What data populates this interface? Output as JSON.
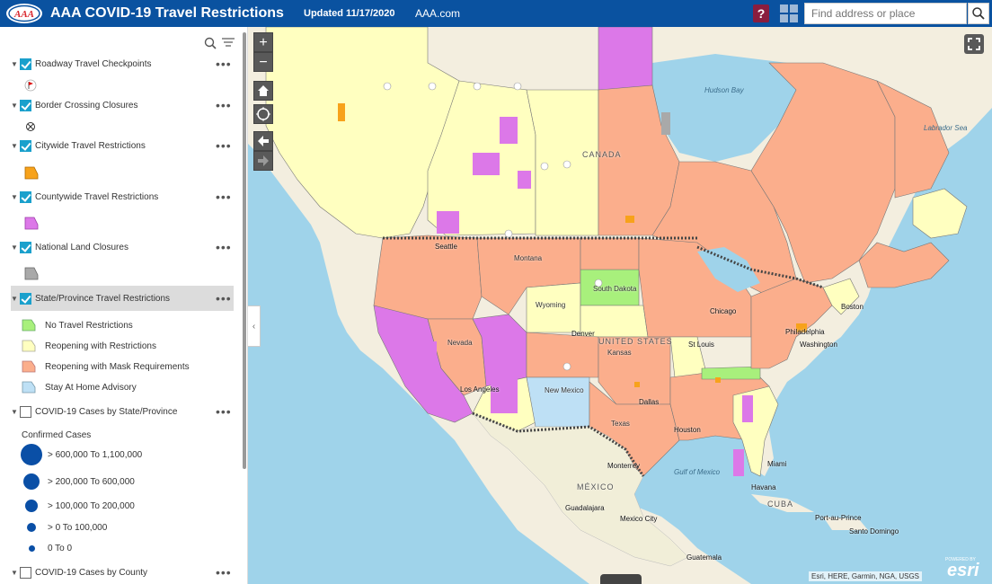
{
  "header": {
    "title": "AAA COVID-19 Travel Restrictions",
    "logo_text": "AAA",
    "updated": "Updated 11/17/2020",
    "link": "AAA.com",
    "help": "?",
    "search_placeholder": "Find address or place"
  },
  "colors": {
    "header_bg": "#0a52a0",
    "no_restrictions": "#a8f07c",
    "reopening_restrictions": "#ffffc0",
    "reopening_masks": "#fbae8c",
    "stay_at_home": "#bee0f5",
    "citywide": "#f7a21b",
    "countywide": "#dc78e8",
    "national_land": "#a9a9a9",
    "cases": "#0a4fa6"
  },
  "layers": [
    {
      "label": "Roadway Travel Checkpoints",
      "checked": true,
      "symbol": "flag-icon"
    },
    {
      "label": "Border Crossing Closures",
      "checked": true,
      "symbol": "crossed-circle-icon"
    },
    {
      "label": "Citywide Travel Restrictions",
      "checked": true,
      "symbol": "orange-polygon"
    },
    {
      "label": "Countywide Travel Restrictions",
      "checked": true,
      "symbol": "magenta-polygon"
    },
    {
      "label": "National Land Closures",
      "checked": true,
      "symbol": "gray-polygon"
    },
    {
      "label": "State/Province Travel Restrictions",
      "checked": true,
      "symbol": ""
    },
    {
      "label": "COVID-19 Cases by State/Province",
      "checked": false,
      "symbol": ""
    },
    {
      "label": "COVID-19 Cases by County",
      "checked": false,
      "symbol": ""
    }
  ],
  "state_legend": [
    {
      "label": "No Travel Restrictions"
    },
    {
      "label": "Reopening with Restrictions"
    },
    {
      "label": "Reopening with Mask Requirements"
    },
    {
      "label": "Stay At Home Advisory"
    }
  ],
  "cases_legend": {
    "title": "Confirmed Cases",
    "items": [
      {
        "label": "> 600,000 To 1,100,000"
      },
      {
        "label": "> 200,000 To 600,000"
      },
      {
        "label": "> 100,000 To 200,000"
      },
      {
        "label": "> 0 To 100,000"
      },
      {
        "label": "0 To 0"
      }
    ]
  },
  "map": {
    "labels": {
      "hudson_bay": "Hudson Bay",
      "labrador_sea": "Labrador Sea",
      "canada": "CANADA",
      "united_states": "UNITED STATES",
      "mexico": "MÉXICO",
      "gulf_of_mexico": "Gulf of Mexico",
      "cuba": "CUBA",
      "seattle": "Seattle",
      "los_angeles": "Los Angeles",
      "denver": "Denver",
      "houston": "Houston",
      "dallas": "Dallas",
      "chicago": "Chicago",
      "st_louis": "St Louis",
      "washington": "Washington",
      "boston": "Boston",
      "miami": "Miami",
      "havana": "Havana",
      "monterrey": "Monterrey",
      "guadalajara": "Guadalajara",
      "mexico_city": "Mexico City",
      "guatemala": "Guatemala",
      "port_au_prince": "Port-au-Prince",
      "santo_domingo": "Santo Domingo",
      "philadelphia": "Philadelphia",
      "south_dakota": "South Dakota",
      "new_mexico": "New Mexico",
      "nevada": "Nevada",
      "wyoming": "Wyoming",
      "montana": "Montana",
      "kansas": "Kansas",
      "texas": "Texas"
    },
    "zoom_in": "+",
    "zoom_out": "−",
    "attribution": "Esri, HERE, Garmin, NGA, USGS",
    "esri_powered": "POWERED BY",
    "esri": "esri"
  }
}
